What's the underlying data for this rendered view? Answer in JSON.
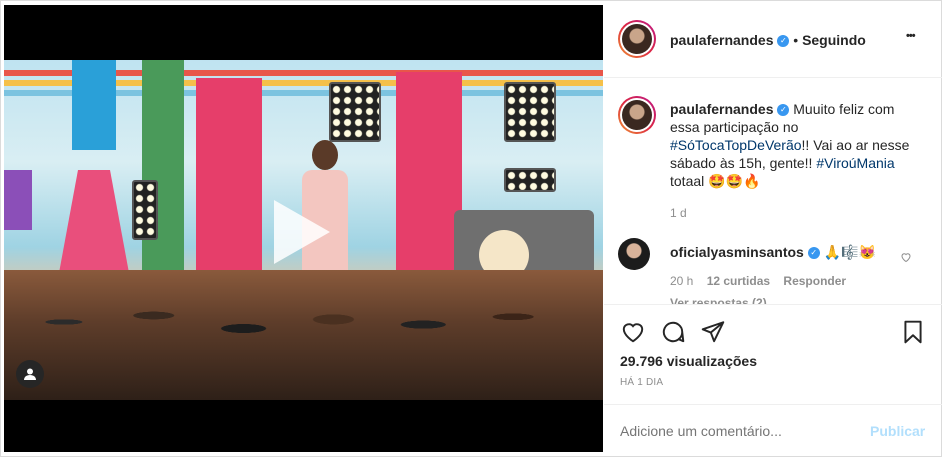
{
  "post": {
    "username": "paulafernandes",
    "follow_status": "Seguindo",
    "separator": "•",
    "more_label": "•••",
    "caption": {
      "text_1": "Muuito feliz com essa participação no",
      "hashtag_1": "#SóTocaTopDeVerão",
      "text_2": "!! Vai ao ar nesse sábado às 15h, gente!!",
      "hashtag_2": "#ViroúMania",
      "text_3": "totaal 🤩🤩🔥",
      "age": "1 d"
    },
    "comment": {
      "username": "oficialyasminsantos",
      "text": "🙏🎼😻",
      "age": "20 h",
      "likes": "12 curtidas",
      "reply_label": "Responder",
      "view_replies": "Ver respostas (2)"
    },
    "views": "29.796 visualizações",
    "timestamp": "HÁ 1 DIA",
    "comment_placeholder": "Adicione um comentário...",
    "publish_label": "Publicar"
  },
  "colors": {
    "accent": "#3897f0",
    "hashtag": "#00376b",
    "muted": "#8e8e8e",
    "publish": "#b2dffc"
  }
}
